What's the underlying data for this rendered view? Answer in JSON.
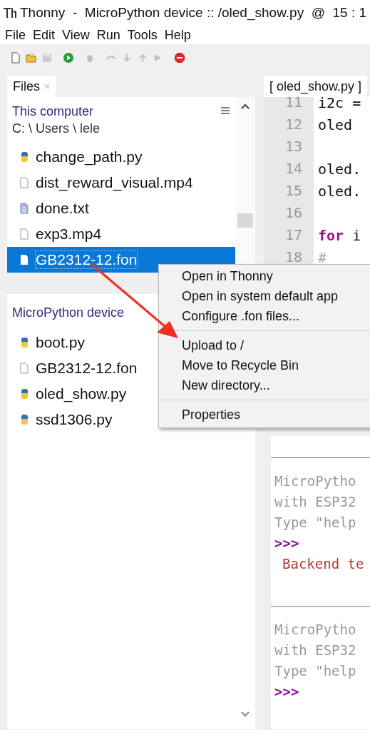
{
  "window": {
    "title": "Thonny  -  MicroPython device :: /oled_show.py  @  15 : 1"
  },
  "menu": [
    {
      "label": "File"
    },
    {
      "label": "Edit"
    },
    {
      "label": "View"
    },
    {
      "label": "Run"
    },
    {
      "label": "Tools"
    },
    {
      "label": "Help"
    }
  ],
  "toolbar": [
    {
      "kind": "new",
      "disabled": false
    },
    {
      "kind": "open",
      "disabled": false
    },
    {
      "kind": "save",
      "disabled": true
    },
    {
      "kind": "run",
      "disabled": false
    },
    {
      "kind": "debug",
      "disabled": true
    },
    {
      "kind": "step-over",
      "disabled": true
    },
    {
      "kind": "step-into",
      "disabled": true
    },
    {
      "kind": "step-out",
      "disabled": true
    },
    {
      "kind": "resume",
      "disabled": true
    },
    {
      "kind": "stop",
      "disabled": false
    }
  ],
  "files_tab": {
    "label": "Files",
    "selected": true
  },
  "local": {
    "heading": "This computer",
    "path": "C: \\ Users \\ lele",
    "files": [
      {
        "name": "change_path.py",
        "kind": "python",
        "selected": false
      },
      {
        "name": "dist_reward_visual.mp4",
        "kind": "file",
        "selected": false
      },
      {
        "name": "done.txt",
        "kind": "text",
        "selected": false
      },
      {
        "name": "exp3.mp4",
        "kind": "file",
        "selected": false
      },
      {
        "name": "GB2312-12.fon",
        "kind": "file",
        "selected": true
      }
    ]
  },
  "device": {
    "heading": "MicroPython device",
    "files": [
      {
        "name": "boot.py",
        "kind": "python",
        "selected": false
      },
      {
        "name": "GB2312-12.fon",
        "kind": "file",
        "selected": false
      },
      {
        "name": "oled_show.py",
        "kind": "python",
        "selected": false
      },
      {
        "name": "ssd1306.py",
        "kind": "python",
        "selected": false
      }
    ]
  },
  "editor": {
    "tab": "[ oled_show.py ]",
    "lines": [
      {
        "number": "11",
        "parts": [
          {
            "text": "i2c =",
            "kind": "plain"
          }
        ]
      },
      {
        "number": "12",
        "parts": [
          {
            "text": "oled",
            "kind": "plain"
          }
        ]
      },
      {
        "number": "13"
      },
      {
        "number": "14",
        "parts": [
          {
            "text": "oled.",
            "kind": "plain"
          }
        ]
      },
      {
        "number": "15",
        "parts": [
          {
            "text": "oled.",
            "kind": "plain"
          }
        ]
      },
      {
        "number": "16"
      },
      {
        "number": "17",
        "parts": [
          {
            "text": "for",
            "kind": "keyword"
          },
          {
            "text": " i",
            "kind": "plain"
          }
        ]
      },
      {
        "number": "18",
        "parts": [
          {
            "text": "#",
            "kind": "comment"
          }
        ]
      }
    ]
  },
  "shell": {
    "sessions": [
      {
        "lines": [
          {
            "text": "MicroPytho",
            "kind": "output"
          },
          {
            "text": "with ESP32",
            "kind": "output"
          },
          {
            "text": "Type \"help",
            "kind": "output"
          },
          {
            "text": ">>>",
            "kind": "prompt"
          },
          {
            "text": "Backend te",
            "kind": "error"
          }
        ]
      },
      {
        "lines": [
          {
            "text": "MicroPytho",
            "kind": "output"
          },
          {
            "text": "with ESP32",
            "kind": "output"
          },
          {
            "text": "Type \"help",
            "kind": "output"
          },
          {
            "text": ">>>",
            "kind": "prompt"
          }
        ]
      }
    ]
  },
  "context_menu": {
    "groups": [
      [
        {
          "label": "Open in Thonny"
        },
        {
          "label": "Open in system default app"
        },
        {
          "label": "Configure .fon files..."
        }
      ],
      [
        {
          "label": "Upload to /"
        },
        {
          "label": "Move to Recycle Bin"
        },
        {
          "label": "New directory..."
        }
      ],
      [
        {
          "label": "Properties"
        }
      ]
    ]
  }
}
